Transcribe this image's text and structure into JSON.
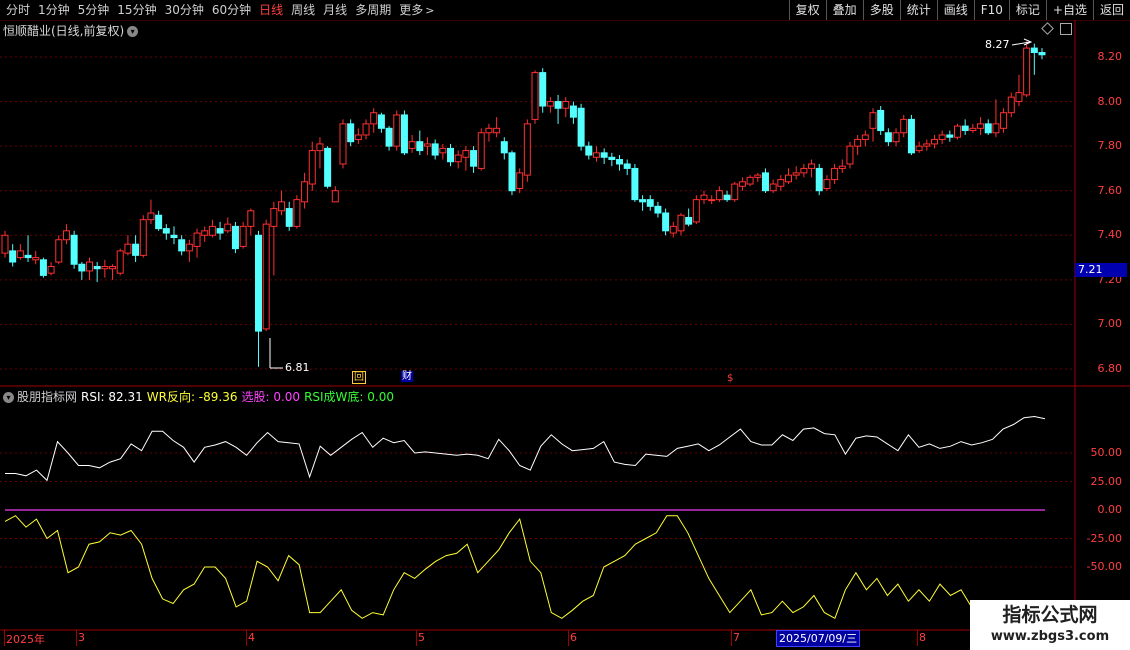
{
  "toolbar": {
    "periods": [
      "分时",
      "1分钟",
      "5分钟",
      "15分钟",
      "30分钟",
      "60分钟",
      "日线",
      "周线",
      "月线",
      "多周期",
      "更多"
    ],
    "active_period": "日线",
    "right_buttons": [
      "复权",
      "叠加",
      "多股",
      "统计",
      "画线",
      "F10",
      "标记",
      "+自选",
      "返回"
    ]
  },
  "stock": {
    "title": "恒顺醋业(日线,前复权)"
  },
  "price_axis": {
    "labels": [
      "8.20",
      "8.00",
      "7.80",
      "7.60",
      "7.40",
      "7.20",
      "7.00",
      "6.80"
    ],
    "current_price": "7.21"
  },
  "annotations": {
    "high": "8.27",
    "low": "6.81",
    "markers": [
      "回",
      "财",
      "$"
    ]
  },
  "indicator": {
    "name": "股朋指标网",
    "rsi": "RSI: 82.31",
    "wr": "WR反向: -89.36",
    "select": "选股: 0.00",
    "rsi_w": "RSI成W底: 0.00",
    "axis": [
      "50.00",
      "25.00",
      "0.00",
      "-25.00",
      "-50.00"
    ]
  },
  "date_axis": {
    "labels": [
      "2025年",
      "3",
      "4",
      "5",
      "6",
      "7",
      "8"
    ],
    "cursor_date": "2025/07/09/三"
  },
  "watermark": {
    "line1": "指标公式网",
    "line2": "www.zbgs3.com"
  },
  "colors": {
    "up": "#ff3030",
    "down": "#54ffff",
    "rsi_line": "#ffffff",
    "wr_line": "#ffff33",
    "zero_line": "#cc33cc",
    "axis": "#ff3030"
  },
  "chart_data": {
    "type": "candlestick",
    "ylim": [
      6.75,
      8.3
    ],
    "candles": [
      {
        "o": 7.32,
        "c": 7.4,
        "h": 7.42,
        "l": 7.3
      },
      {
        "o": 7.33,
        "c": 7.28,
        "h": 7.36,
        "l": 7.26
      },
      {
        "o": 7.3,
        "c": 7.33,
        "h": 7.36,
        "l": 7.29
      },
      {
        "o": 7.31,
        "c": 7.3,
        "h": 7.4,
        "l": 7.28
      },
      {
        "o": 7.29,
        "c": 7.3,
        "h": 7.33,
        "l": 7.27
      },
      {
        "o": 7.29,
        "c": 7.22,
        "h": 7.3,
        "l": 7.21
      },
      {
        "o": 7.23,
        "c": 7.26,
        "h": 7.28,
        "l": 7.22
      },
      {
        "o": 7.28,
        "c": 7.38,
        "h": 7.4,
        "l": 7.27
      },
      {
        "o": 7.38,
        "c": 7.42,
        "h": 7.45,
        "l": 7.36
      },
      {
        "o": 7.4,
        "c": 7.27,
        "h": 7.42,
        "l": 7.25
      },
      {
        "o": 7.27,
        "c": 7.24,
        "h": 7.28,
        "l": 7.2
      },
      {
        "o": 7.24,
        "c": 7.28,
        "h": 7.3,
        "l": 7.2
      },
      {
        "o": 7.26,
        "c": 7.25,
        "h": 7.28,
        "l": 7.19
      },
      {
        "o": 7.25,
        "c": 7.26,
        "h": 7.29,
        "l": 7.21
      },
      {
        "o": 7.25,
        "c": 7.26,
        "h": 7.27,
        "l": 7.2
      },
      {
        "o": 7.23,
        "c": 7.33,
        "h": 7.34,
        "l": 7.22
      },
      {
        "o": 7.32,
        "c": 7.36,
        "h": 7.4,
        "l": 7.31
      },
      {
        "o": 7.36,
        "c": 7.31,
        "h": 7.4,
        "l": 7.28
      },
      {
        "o": 7.31,
        "c": 7.47,
        "h": 7.49,
        "l": 7.3
      },
      {
        "o": 7.47,
        "c": 7.5,
        "h": 7.56,
        "l": 7.45
      },
      {
        "o": 7.49,
        "c": 7.43,
        "h": 7.51,
        "l": 7.42
      },
      {
        "o": 7.43,
        "c": 7.41,
        "h": 7.45,
        "l": 7.38
      },
      {
        "o": 7.4,
        "c": 7.39,
        "h": 7.44,
        "l": 7.36
      },
      {
        "o": 7.38,
        "c": 7.33,
        "h": 7.4,
        "l": 7.31
      },
      {
        "o": 7.33,
        "c": 7.36,
        "h": 7.38,
        "l": 7.28
      },
      {
        "o": 7.35,
        "c": 7.41,
        "h": 7.43,
        "l": 7.3
      },
      {
        "o": 7.4,
        "c": 7.42,
        "h": 7.44,
        "l": 7.37
      },
      {
        "o": 7.4,
        "c": 7.44,
        "h": 7.47,
        "l": 7.39
      },
      {
        "o": 7.43,
        "c": 7.41,
        "h": 7.46,
        "l": 7.38
      },
      {
        "o": 7.42,
        "c": 7.45,
        "h": 7.48,
        "l": 7.41
      },
      {
        "o": 7.44,
        "c": 7.34,
        "h": 7.46,
        "l": 7.32
      },
      {
        "o": 7.35,
        "c": 7.44,
        "h": 7.46,
        "l": 7.34
      },
      {
        "o": 7.44,
        "c": 7.51,
        "h": 7.52,
        "l": 7.4
      },
      {
        "o": 7.4,
        "c": 6.97,
        "h": 7.42,
        "l": 6.81
      },
      {
        "o": 6.98,
        "c": 7.45,
        "h": 7.47,
        "l": 6.97
      },
      {
        "o": 7.44,
        "c": 7.52,
        "h": 7.55,
        "l": 7.22
      },
      {
        "o": 7.51,
        "c": 7.55,
        "h": 7.6,
        "l": 7.49
      },
      {
        "o": 7.52,
        "c": 7.44,
        "h": 7.55,
        "l": 7.42
      },
      {
        "o": 7.44,
        "c": 7.56,
        "h": 7.58,
        "l": 7.43
      },
      {
        "o": 7.55,
        "c": 7.64,
        "h": 7.68,
        "l": 7.52
      },
      {
        "o": 7.63,
        "c": 7.78,
        "h": 7.82,
        "l": 7.6
      },
      {
        "o": 7.78,
        "c": 7.81,
        "h": 7.84,
        "l": 7.7
      },
      {
        "o": 7.79,
        "c": 7.62,
        "h": 7.8,
        "l": 7.61
      },
      {
        "o": 7.55,
        "c": 7.6,
        "h": 7.62,
        "l": 7.55
      },
      {
        "o": 7.72,
        "c": 7.9,
        "h": 7.92,
        "l": 7.7
      },
      {
        "o": 7.9,
        "c": 7.82,
        "h": 7.92,
        "l": 7.8
      },
      {
        "o": 7.83,
        "c": 7.85,
        "h": 7.88,
        "l": 7.81
      },
      {
        "o": 7.85,
        "c": 7.9,
        "h": 7.92,
        "l": 7.83
      },
      {
        "o": 7.9,
        "c": 7.95,
        "h": 7.97,
        "l": 7.86
      },
      {
        "o": 7.94,
        "c": 7.88,
        "h": 7.95,
        "l": 7.86
      },
      {
        "o": 7.88,
        "c": 7.8,
        "h": 7.89,
        "l": 7.78
      },
      {
        "o": 7.8,
        "c": 7.94,
        "h": 7.96,
        "l": 7.78
      },
      {
        "o": 7.94,
        "c": 7.77,
        "h": 7.96,
        "l": 7.76
      },
      {
        "o": 7.79,
        "c": 7.82,
        "h": 7.85,
        "l": 7.77
      },
      {
        "o": 7.82,
        "c": 7.78,
        "h": 7.87,
        "l": 7.76
      },
      {
        "o": 7.8,
        "c": 7.81,
        "h": 7.84,
        "l": 7.76
      },
      {
        "o": 7.81,
        "c": 7.76,
        "h": 7.83,
        "l": 7.74
      },
      {
        "o": 7.77,
        "c": 7.79,
        "h": 7.81,
        "l": 7.74
      },
      {
        "o": 7.79,
        "c": 7.73,
        "h": 7.81,
        "l": 7.71
      },
      {
        "o": 7.73,
        "c": 7.76,
        "h": 7.78,
        "l": 7.7
      },
      {
        "o": 7.75,
        "c": 7.78,
        "h": 7.8,
        "l": 7.69
      },
      {
        "o": 7.78,
        "c": 7.71,
        "h": 7.8,
        "l": 7.68
      },
      {
        "o": 7.7,
        "c": 7.86,
        "h": 7.88,
        "l": 7.69
      },
      {
        "o": 7.86,
        "c": 7.88,
        "h": 7.9,
        "l": 7.82
      },
      {
        "o": 7.86,
        "c": 7.88,
        "h": 7.93,
        "l": 7.84
      },
      {
        "o": 7.82,
        "c": 7.77,
        "h": 7.84,
        "l": 7.74
      },
      {
        "o": 7.77,
        "c": 7.6,
        "h": 7.78,
        "l": 7.58
      },
      {
        "o": 7.61,
        "c": 7.68,
        "h": 7.7,
        "l": 7.59
      },
      {
        "o": 7.67,
        "c": 7.9,
        "h": 7.92,
        "l": 7.64
      },
      {
        "o": 7.92,
        "c": 8.13,
        "h": 8.14,
        "l": 7.9
      },
      {
        "o": 8.13,
        "c": 7.98,
        "h": 8.15,
        "l": 7.95
      },
      {
        "o": 7.98,
        "c": 8.0,
        "h": 8.02,
        "l": 7.95
      },
      {
        "o": 8.0,
        "c": 7.97,
        "h": 8.03,
        "l": 7.9
      },
      {
        "o": 7.97,
        "c": 8.0,
        "h": 8.02,
        "l": 7.93
      },
      {
        "o": 7.98,
        "c": 7.93,
        "h": 8.0,
        "l": 7.9
      },
      {
        "o": 7.97,
        "c": 7.8,
        "h": 7.99,
        "l": 7.78
      },
      {
        "o": 7.8,
        "c": 7.76,
        "h": 7.82,
        "l": 7.74
      },
      {
        "o": 7.75,
        "c": 7.77,
        "h": 7.8,
        "l": 7.73
      },
      {
        "o": 7.77,
        "c": 7.75,
        "h": 7.79,
        "l": 7.72
      },
      {
        "o": 7.75,
        "c": 7.74,
        "h": 7.77,
        "l": 7.71
      },
      {
        "o": 7.74,
        "c": 7.72,
        "h": 7.76,
        "l": 7.69
      },
      {
        "o": 7.72,
        "c": 7.7,
        "h": 7.74,
        "l": 7.67
      },
      {
        "o": 7.7,
        "c": 7.56,
        "h": 7.72,
        "l": 7.55
      },
      {
        "o": 7.56,
        "c": 7.55,
        "h": 7.58,
        "l": 7.51
      },
      {
        "o": 7.56,
        "c": 7.53,
        "h": 7.58,
        "l": 7.51
      },
      {
        "o": 7.53,
        "c": 7.5,
        "h": 7.55,
        "l": 7.48
      },
      {
        "o": 7.5,
        "c": 7.42,
        "h": 7.52,
        "l": 7.4
      },
      {
        "o": 7.41,
        "c": 7.44,
        "h": 7.46,
        "l": 7.39
      },
      {
        "o": 7.42,
        "c": 7.49,
        "h": 7.5,
        "l": 7.4
      },
      {
        "o": 7.48,
        "c": 7.45,
        "h": 7.52,
        "l": 7.44
      },
      {
        "o": 7.46,
        "c": 7.56,
        "h": 7.58,
        "l": 7.45
      },
      {
        "o": 7.56,
        "c": 7.58,
        "h": 7.6,
        "l": 7.54
      },
      {
        "o": 7.56,
        "c": 7.56,
        "h": 7.58,
        "l": 7.54
      },
      {
        "o": 7.56,
        "c": 7.6,
        "h": 7.62,
        "l": 7.55
      },
      {
        "o": 7.58,
        "c": 7.56,
        "h": 7.6,
        "l": 7.55
      },
      {
        "o": 7.56,
        "c": 7.63,
        "h": 7.64,
        "l": 7.55
      },
      {
        "o": 7.62,
        "c": 7.64,
        "h": 7.66,
        "l": 7.6
      },
      {
        "o": 7.63,
        "c": 7.66,
        "h": 7.67,
        "l": 7.62
      },
      {
        "o": 7.66,
        "c": 7.67,
        "h": 7.68,
        "l": 7.64
      },
      {
        "o": 7.68,
        "c": 7.6,
        "h": 7.7,
        "l": 7.59
      },
      {
        "o": 7.6,
        "c": 7.63,
        "h": 7.65,
        "l": 7.59
      },
      {
        "o": 7.62,
        "c": 7.65,
        "h": 7.67,
        "l": 7.6
      },
      {
        "o": 7.64,
        "c": 7.67,
        "h": 7.7,
        "l": 7.63
      },
      {
        "o": 7.67,
        "c": 7.68,
        "h": 7.71,
        "l": 7.65
      },
      {
        "o": 7.68,
        "c": 7.7,
        "h": 7.72,
        "l": 7.66
      },
      {
        "o": 7.7,
        "c": 7.72,
        "h": 7.74,
        "l": 7.66
      },
      {
        "o": 7.7,
        "c": 7.6,
        "h": 7.72,
        "l": 7.58
      },
      {
        "o": 7.61,
        "c": 7.65,
        "h": 7.67,
        "l": 7.6
      },
      {
        "o": 7.65,
        "c": 7.7,
        "h": 7.72,
        "l": 7.63
      },
      {
        "o": 7.7,
        "c": 7.71,
        "h": 7.74,
        "l": 7.68
      },
      {
        "o": 7.72,
        "c": 7.8,
        "h": 7.82,
        "l": 7.7
      },
      {
        "o": 7.8,
        "c": 7.83,
        "h": 7.85,
        "l": 7.76
      },
      {
        "o": 7.83,
        "c": 7.85,
        "h": 7.87,
        "l": 7.8
      },
      {
        "o": 7.88,
        "c": 7.95,
        "h": 7.97,
        "l": 7.82
      },
      {
        "o": 7.96,
        "c": 7.87,
        "h": 7.98,
        "l": 7.85
      },
      {
        "o": 7.86,
        "c": 7.82,
        "h": 7.88,
        "l": 7.8
      },
      {
        "o": 7.82,
        "c": 7.86,
        "h": 7.88,
        "l": 7.8
      },
      {
        "o": 7.86,
        "c": 7.92,
        "h": 7.94,
        "l": 7.84
      },
      {
        "o": 7.92,
        "c": 7.77,
        "h": 7.94,
        "l": 7.76
      },
      {
        "o": 7.78,
        "c": 7.8,
        "h": 7.82,
        "l": 7.77
      },
      {
        "o": 7.8,
        "c": 7.81,
        "h": 7.83,
        "l": 7.78
      },
      {
        "o": 7.81,
        "c": 7.83,
        "h": 7.85,
        "l": 7.79
      },
      {
        "o": 7.83,
        "c": 7.85,
        "h": 7.87,
        "l": 7.81
      },
      {
        "o": 7.85,
        "c": 7.84,
        "h": 7.87,
        "l": 7.82
      },
      {
        "o": 7.84,
        "c": 7.89,
        "h": 7.9,
        "l": 7.83
      },
      {
        "o": 7.89,
        "c": 7.87,
        "h": 7.92,
        "l": 7.85
      },
      {
        "o": 7.87,
        "c": 7.88,
        "h": 7.9,
        "l": 7.86
      },
      {
        "o": 7.88,
        "c": 7.9,
        "h": 7.93,
        "l": 7.85
      },
      {
        "o": 7.9,
        "c": 7.86,
        "h": 7.92,
        "l": 7.85
      },
      {
        "o": 7.86,
        "c": 7.9,
        "h": 8.01,
        "l": 7.84
      },
      {
        "o": 7.88,
        "c": 7.95,
        "h": 7.97,
        "l": 7.86
      },
      {
        "o": 7.95,
        "c": 8.02,
        "h": 8.04,
        "l": 7.93
      },
      {
        "o": 8.0,
        "c": 8.04,
        "h": 8.12,
        "l": 7.98
      },
      {
        "o": 8.03,
        "c": 8.24,
        "h": 8.27,
        "l": 8.02
      },
      {
        "o": 8.24,
        "c": 8.22,
        "h": 8.26,
        "l": 8.12
      },
      {
        "o": 8.22,
        "c": 8.21,
        "h": 8.24,
        "l": 8.19
      }
    ],
    "rsi": [
      32,
      32,
      30,
      35,
      26,
      60,
      50,
      39,
      39,
      37,
      42,
      45,
      58,
      52,
      69,
      69,
      61,
      55,
      42,
      55,
      57,
      60,
      55,
      48,
      59,
      68,
      60,
      59,
      58,
      29,
      56,
      48,
      55,
      62,
      68,
      55,
      63,
      59,
      61,
      50,
      51,
      50,
      49,
      48,
      49,
      48,
      45,
      62,
      52,
      39,
      35,
      56,
      66,
      58,
      52,
      53,
      54,
      60,
      42,
      40,
      39,
      49,
      48,
      47,
      54,
      56,
      58,
      52,
      57,
      64,
      71,
      60,
      57,
      57,
      66,
      61,
      71,
      72,
      67,
      66,
      49,
      63,
      65,
      64,
      58,
      52,
      66,
      55,
      58,
      54,
      56,
      60,
      57,
      59,
      62,
      71,
      75,
      81,
      82,
      80
    ],
    "wr": [
      -10,
      -5,
      -15,
      -8,
      -25,
      -18,
      -55,
      -50,
      -30,
      -28,
      -20,
      -22,
      -18,
      -30,
      -60,
      -78,
      -82,
      -70,
      -65,
      -50,
      -50,
      -60,
      -85,
      -80,
      -45,
      -50,
      -62,
      -40,
      -48,
      -90,
      -90,
      -80,
      -70,
      -88,
      -95,
      -90,
      -92,
      -70,
      -55,
      -60,
      -52,
      -45,
      -40,
      -38,
      -30,
      -55,
      -45,
      -35,
      -20,
      -8,
      -45,
      -55,
      -90,
      -95,
      -88,
      -80,
      -75,
      -50,
      -45,
      -40,
      -30,
      -25,
      -20,
      -5,
      -5,
      -20,
      -40,
      -60,
      -75,
      -90,
      -80,
      -70,
      -92,
      -90,
      -80,
      -90,
      -85,
      -75,
      -90,
      -95,
      -70,
      -55,
      -70,
      -60,
      -75,
      -65,
      -80,
      -70,
      -80,
      -65,
      -75,
      -70,
      -85,
      -80,
      -90,
      -85,
      -95,
      -99,
      -100,
      -105
    ]
  }
}
